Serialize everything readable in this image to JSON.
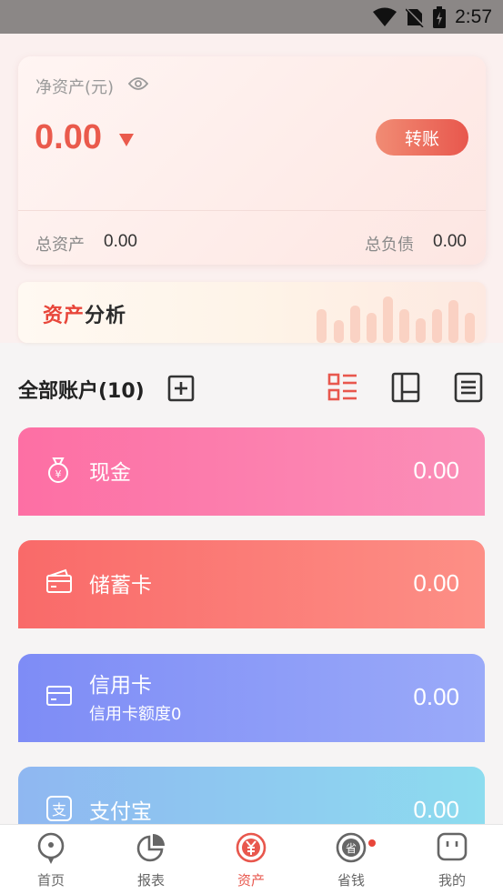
{
  "status_bar": {
    "time": "2:57"
  },
  "net_assets": {
    "label": "净资产(元)",
    "value": "0.00",
    "transfer_button": "转账",
    "total_assets_label": "总资产",
    "total_assets_value": "0.00",
    "total_debt_label": "总负债",
    "total_debt_value": "0.00"
  },
  "analysis_banner": {
    "title_part1": "资产",
    "title_part2": "分析"
  },
  "accounts_section": {
    "title": "全部账户(10)"
  },
  "accounts": [
    {
      "name": "现金",
      "value": "0.00",
      "color_from": "#fd6fa4",
      "color_to": "#fb8fb8",
      "icon": "money-bag-icon"
    },
    {
      "name": "储蓄卡",
      "value": "0.00",
      "color_from": "#f96a69",
      "color_to": "#fd8f86",
      "icon": "bank-card-icon"
    },
    {
      "name": "信用卡",
      "sub": "信用卡额度0",
      "value": "0.00",
      "color_from": "#7e8cf6",
      "color_to": "#9aaaf9",
      "icon": "credit-card-icon"
    },
    {
      "name": "支付宝",
      "value": "0.00",
      "color_from": "#8fb7f1",
      "color_to": "#8ddcef",
      "icon": "alipay-icon"
    }
  ],
  "tabbar": [
    {
      "label": "首页",
      "icon": "home-icon",
      "active": false
    },
    {
      "label": "报表",
      "icon": "pie-chart-icon",
      "active": false
    },
    {
      "label": "资产",
      "icon": "yen-icon",
      "active": true
    },
    {
      "label": "省钱",
      "icon": "save-money-icon",
      "active": false,
      "badge_dot": true
    },
    {
      "label": "我的",
      "icon": "profile-icon",
      "active": false
    }
  ],
  "colors": {
    "accent": "#e8574d",
    "status_bar": "#8b8786"
  }
}
